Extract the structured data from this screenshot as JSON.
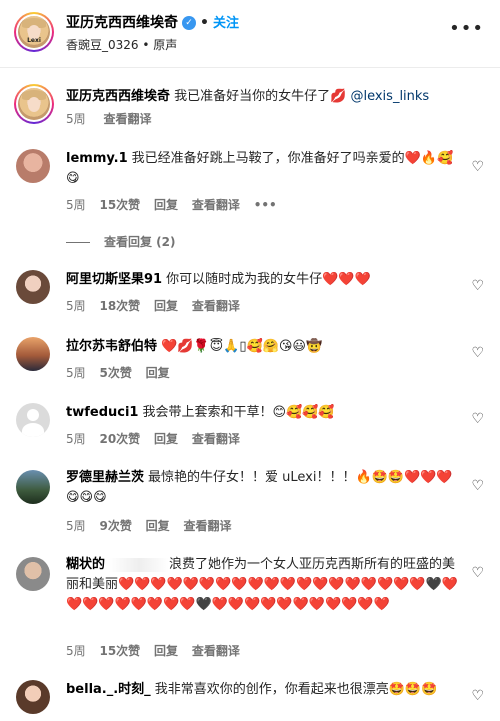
{
  "header": {
    "username": "亚历克西西维埃奇",
    "follow_label": "关注",
    "dot": "•",
    "subtitle": "香豌豆_0326 • 原声",
    "avatar_text": "Lexi"
  },
  "caption": {
    "username": "亚历克西西维埃奇",
    "text": "我已准备好当你的女牛仔了💋",
    "mention": "@lexis_links",
    "time": "5周",
    "translate": "查看翻译"
  },
  "comments": [
    {
      "username": "lemmy.1",
      "text": "我已经准备好跳上马鞍了，你准备好了吗亲爱的❤️🔥🥰😋",
      "time": "5周",
      "likes": "15次赞",
      "reply": "回复",
      "translate": "查看翻译",
      "more": "•••",
      "view_replies": "查看回复 (2)"
    },
    {
      "username": "阿里切斯坚果91",
      "text": "你可以随时成为我的女牛仔❤️❤️❤️",
      "time": "5周",
      "likes": "18次赞",
      "reply": "回复",
      "translate": "查看翻译"
    },
    {
      "username": "拉尔苏韦舒伯特",
      "text": "❤️💋🌹😇🙏▯🥰🤗😘😃🤠",
      "time": "5周",
      "likes": "5次赞",
      "reply": "回复"
    },
    {
      "username": "twfeduci1",
      "text": "我会带上套索和干草！😊🥰🥰🥰",
      "time": "5周",
      "likes": "20次赞",
      "reply": "回复",
      "translate": "查看翻译"
    },
    {
      "username": "罗德里赫兰茨",
      "text": "最惊艳的牛仔女！！爱 uLexi！！！🔥🤩🤩❤️❤️❤️😋😋😋",
      "time": "5周",
      "likes": "9次赞",
      "reply": "回复",
      "translate": "查看翻译"
    },
    {
      "username": "糊状的",
      "text": "浪费了她作为一个女人亚历克西斯所有的旺盛的美丽和美丽❤️❤️❤️❤️❤️❤️❤️❤️❤️❤️❤️❤️❤️❤️❤️❤️❤️❤️❤️🖤❤️❤️❤️❤️❤️❤️❤️❤️❤️🖤❤️❤️❤️❤️❤️❤️❤️❤️❤️❤️❤️",
      "time": "5周",
      "likes": "15次赞",
      "reply": "回复",
      "translate": "查看翻译"
    },
    {
      "username": "bella._.时刻_",
      "text": "我非常喜欢你的创作，你看起来也很漂亮🤩🤩🤩"
    }
  ],
  "icons": {
    "more": "more-icon",
    "heart": "heart-outline-icon",
    "verified": "verified-badge-icon"
  },
  "colors": {
    "link_blue": "#0095f6",
    "mention_blue": "#00376b",
    "muted": "#737373"
  }
}
